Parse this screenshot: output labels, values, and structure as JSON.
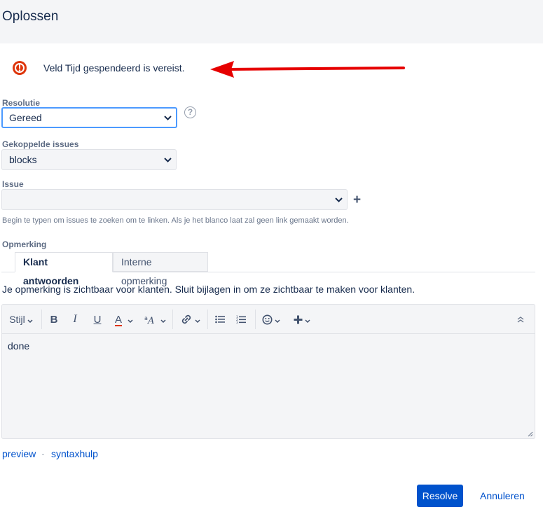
{
  "dialog": {
    "title": "Oplossen"
  },
  "error": {
    "message": "Veld Tijd gespendeerd is vereist.",
    "icon": "error-icon",
    "color": "#de350b",
    "arrow_color": "#e60000"
  },
  "resolution": {
    "label": "Resolutie",
    "value": "Gereed"
  },
  "linked_issues": {
    "label": "Gekoppelde issues",
    "value": "blocks"
  },
  "issue": {
    "label": "Issue",
    "value": "",
    "hint": "Begin te typen om issues te zoeken om te linken. Als je het blanco laat zal geen link gemaakt worden."
  },
  "comment": {
    "label": "Opmerking",
    "tabs": [
      {
        "label": "Klant antwoorden",
        "active": true
      },
      {
        "label": "Interne opmerking",
        "active": false
      }
    ],
    "visibility_note": "Je opmerking is zichtbaar voor klanten. Sluit bijlagen in om ze zichtbaar te maken voor klanten.",
    "toolbar": {
      "style_label": "Stijl",
      "bold": "B",
      "italic": "I",
      "underline": "U",
      "text_color": "A"
    },
    "text": "done",
    "links": {
      "preview": "preview",
      "separator": "·",
      "syntax": "syntaxhulp"
    }
  },
  "actions": {
    "resolve": "Resolve",
    "cancel": "Annuleren"
  },
  "colors": {
    "accent": "#0052cc",
    "focus": "#4c9aff",
    "text_color_underline": "#de350b"
  }
}
